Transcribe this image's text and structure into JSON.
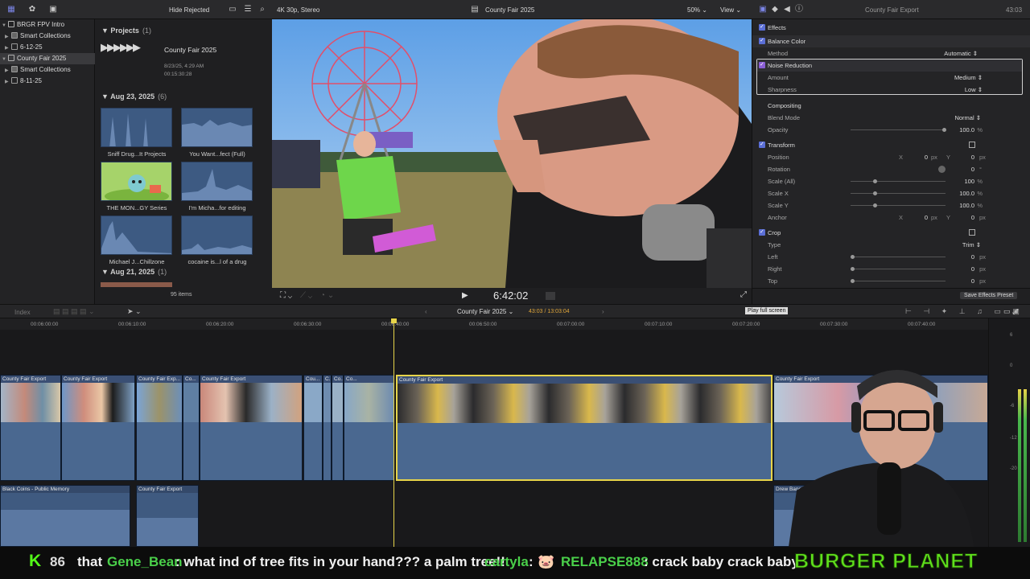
{
  "toolbar": {
    "hide_rejected": "Hide Rejected",
    "format": "4K 30p, Stereo",
    "project_title": "County Fair 2025",
    "zoom": "50%",
    "view": "View",
    "inspector_title": "County Fair Export",
    "duration": "43:03"
  },
  "library": {
    "items": [
      {
        "label": "BRGR FPV Intro"
      },
      {
        "label": "Smart Collections"
      },
      {
        "label": "6-12-25"
      },
      {
        "label": "County Fair 2025"
      },
      {
        "label": "Smart Collections"
      },
      {
        "label": "8-11-25"
      }
    ]
  },
  "browser": {
    "projects_header": "Projects",
    "projects_count": "(1)",
    "project_name": "County Fair 2025",
    "project_date": "8/23/25, 4:29 AM",
    "project_duration": "00:15:30:28",
    "aug23_header": "Aug 23, 2025",
    "aug23_count": "(6)",
    "clips": [
      {
        "label": "Sniff Drug...It Projects"
      },
      {
        "label": "You Want...fect (Full)"
      },
      {
        "label": "THE MON...GY Series"
      },
      {
        "label": "I'm Micha...for editing"
      },
      {
        "label": "Michael J...Chillzone"
      },
      {
        "label": "cocaine is...l of a drug"
      }
    ],
    "aug21_header": "Aug 21, 2025",
    "aug21_count": "(1)",
    "item_count": "95 items"
  },
  "viewer": {
    "timecode": "6:42:02"
  },
  "inspector": {
    "effects": "Effects",
    "balance_color": "Balance Color",
    "method_label": "Method",
    "method_value": "Automatic",
    "noise_reduction": "Noise Reduction",
    "amount_label": "Amount",
    "amount_value": "Medium",
    "sharpness_label": "Sharpness",
    "sharpness_value": "Low",
    "compositing": "Compositing",
    "blend_label": "Blend Mode",
    "blend_value": "Normal",
    "opacity_label": "Opacity",
    "opacity_value": "100.0",
    "transform": "Transform",
    "position_label": "Position",
    "pos_x": "0",
    "pos_y": "0",
    "rotation_label": "Rotation",
    "rotation_value": "0",
    "scale_all_label": "Scale (All)",
    "scale_all_value": "100",
    "scale_x_label": "Scale X",
    "scale_x_value": "100.0",
    "scale_y_label": "Scale Y",
    "scale_y_value": "100.0",
    "anchor_label": "Anchor",
    "anchor_x": "0",
    "anchor_y": "0",
    "crop": "Crop",
    "type_label": "Type",
    "type_value": "Trim",
    "left_label": "Left",
    "left_value": "0",
    "right_label": "Right",
    "right_value": "0",
    "top_label": "Top",
    "top_value": "0",
    "save_preset": "Save Effects Preset",
    "tooltip": "Play full screen",
    "unit_px": "px",
    "unit_pct": "%",
    "unit_deg": "°",
    "x_label": "X",
    "y_label": "Y"
  },
  "timeline": {
    "index": "Index",
    "project": "County Fair 2025",
    "position": "43:03 / 13:03:04",
    "ruler": [
      "00:06:00:00",
      "00:06:10:00",
      "00:06:20:00",
      "00:06:30:00",
      "00:06:40:00",
      "00:06:50:00",
      "00:07:00:00",
      "00:07:10:00",
      "00:07:20:00",
      "00:07:30:00",
      "00:07:40:00"
    ],
    "clips": [
      "County Fair Export",
      "County Fair Export",
      "County Fair Exp...",
      "Co...",
      "County Fair Export",
      "Cou...",
      "C...",
      "Co...",
      "Co...",
      "County Fair Export",
      "County Fair Export"
    ],
    "audio_clips": [
      "Black Coins - Public Memory",
      "County Fair Export",
      "Drew Banga - M..."
    ],
    "meter_marks": [
      "6",
      "0",
      "-6",
      "-12",
      "-20"
    ]
  },
  "chat": {
    "count": "86",
    "msg1": "that",
    "user1": "Gene_Bean",
    "text1": ": what ind of tree fits in your hand??? a palm tree!!",
    "user2": "cartyla",
    "text2": ":",
    "user3": "RELAPSE888",
    "text3": ": crack baby crack baby",
    "brand": "BURGER PLANET"
  }
}
